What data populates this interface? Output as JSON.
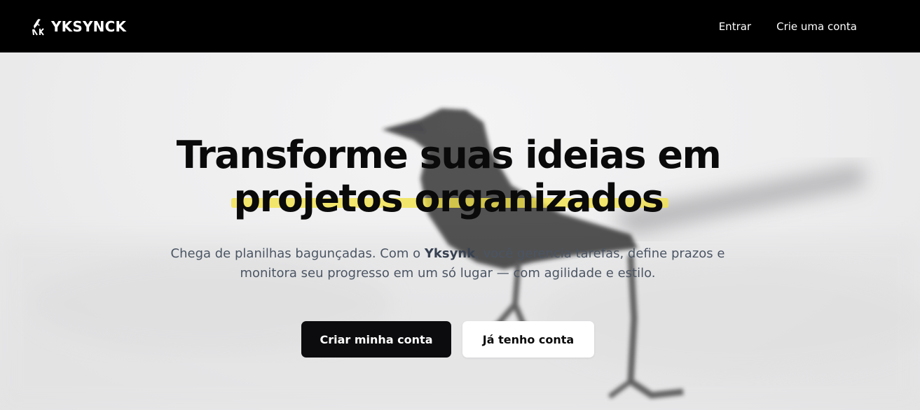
{
  "nav": {
    "brand_name": "YKSYNCK",
    "links": [
      {
        "label": "Entrar"
      },
      {
        "label": "Crie uma conta"
      }
    ]
  },
  "hero": {
    "headline_line1": "Transforme suas ideias em",
    "headline_line2": "projetos organizados",
    "subtitle_before": "Chega de planilhas bagunçadas. Com o ",
    "subtitle_brand": "Yksynk",
    "subtitle_after": ", você gerencia tarefas, define prazos e monitora seu progresso em um só lugar — com agilidade e estilo.",
    "primary_button": "Criar minha conta",
    "secondary_button": "Já tenho conta"
  },
  "colors": {
    "nav_background": "#000000",
    "highlight": "#f3e24a",
    "primary_button": "#0c0c0e",
    "secondary_button": "#ffffff"
  },
  "icons": {
    "brand_logo": "bird-logo-icon",
    "background": "crow-photo"
  }
}
